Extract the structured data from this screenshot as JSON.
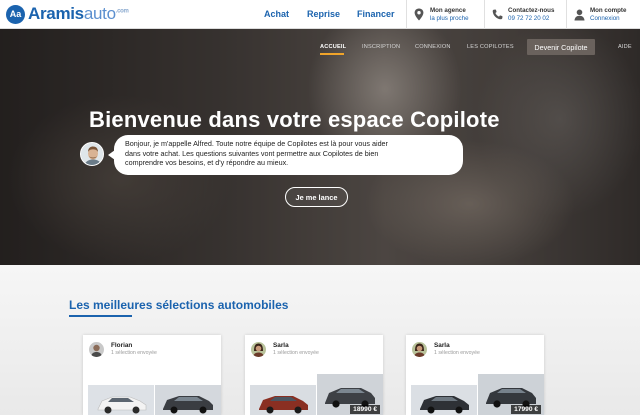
{
  "brand": {
    "badge": "Aa",
    "name_bold": "Aramis",
    "name_light": "auto",
    "name_suffix": ".com"
  },
  "nav": {
    "achat": "Achat",
    "reprise": "Reprise",
    "financer": "Financer"
  },
  "header_blocks": {
    "agence": {
      "line1": "Mon agence",
      "line2": "la plus proche"
    },
    "contact": {
      "line1": "Contactez-nous",
      "line2": "09 72 72 20 02"
    },
    "compte": {
      "line1": "Mon compte",
      "line2": "Connexion"
    }
  },
  "subnav": {
    "accueil": "ACCUEIL",
    "inscription": "INSCRIPTION",
    "connexion": "CONNEXION",
    "copilotes": "LES COPILOTES",
    "devenir": "Devenir Copilote",
    "aide": "AIDE"
  },
  "hero": {
    "title": "Bienvenue dans votre espace Copilote",
    "bubble_lines": [
      "Bonjour, je m'appelle Alfred. Toute notre équipe de Copilotes est là pour vous aider",
      "dans votre achat. Les questions suivantes vont permettre aux Copilotes de bien",
      "comprendre vos besoins, et d'y répondre au mieux."
    ],
    "cta": "Je me lance"
  },
  "selections": {
    "title": "Les meilleures sélections automobiles",
    "cards": [
      {
        "name": "Florian",
        "sub": "1 sélection envoyée",
        "price": ""
      },
      {
        "name": "Sarla",
        "sub": "1 sélection envoyée",
        "price": "18990 €"
      },
      {
        "name": "Sarla",
        "sub": "1 sélection envoyée",
        "price": "17990 €"
      }
    ]
  },
  "colors": {
    "brand_blue": "#1b63ae",
    "accent_orange": "#f0a42a",
    "devenir_bg": "#6a625d"
  }
}
